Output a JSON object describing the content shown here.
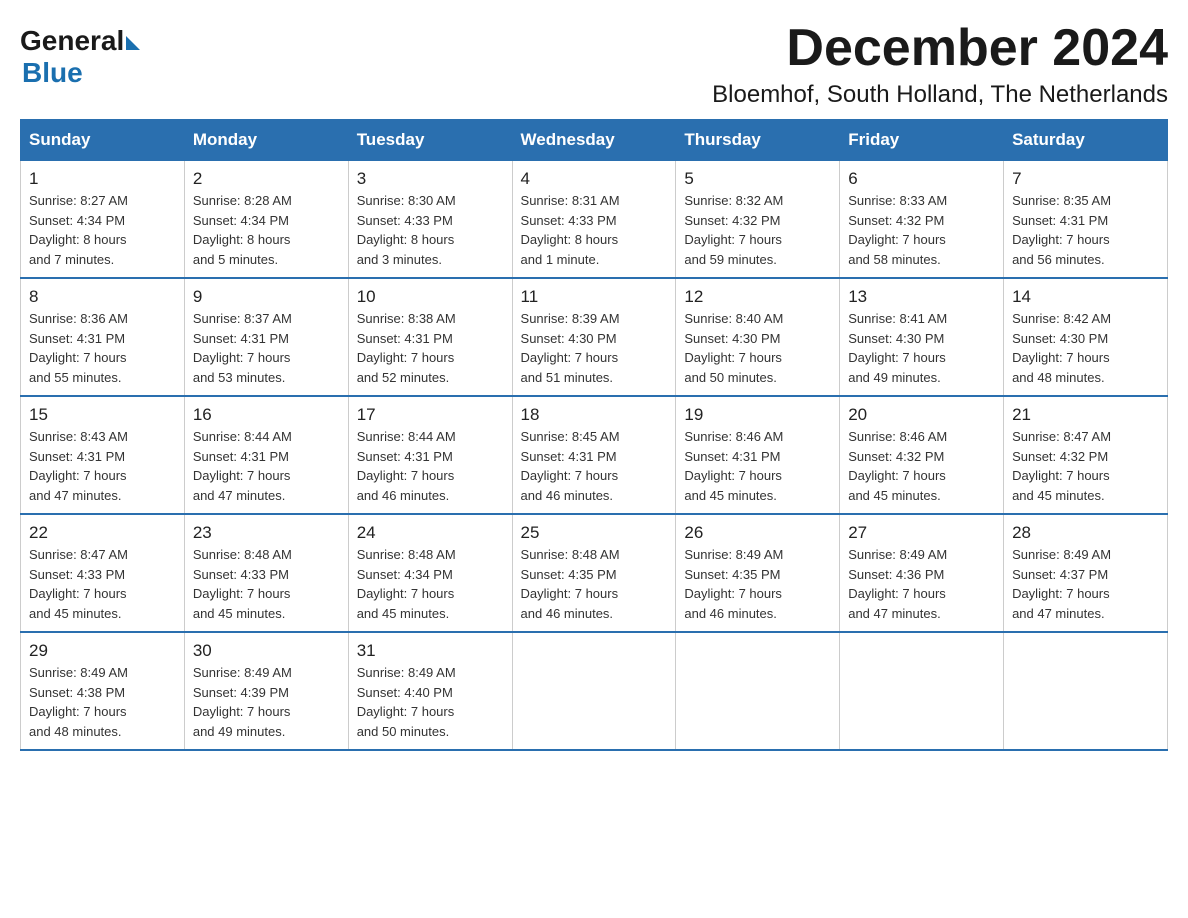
{
  "logo": {
    "general": "General",
    "blue": "Blue"
  },
  "title": {
    "month": "December 2024",
    "location": "Bloemhof, South Holland, The Netherlands"
  },
  "weekdays": [
    "Sunday",
    "Monday",
    "Tuesday",
    "Wednesday",
    "Thursday",
    "Friday",
    "Saturday"
  ],
  "weeks": [
    [
      {
        "day": "1",
        "sunrise": "8:27 AM",
        "sunset": "4:34 PM",
        "daylight": "8 hours and 7 minutes."
      },
      {
        "day": "2",
        "sunrise": "8:28 AM",
        "sunset": "4:34 PM",
        "daylight": "8 hours and 5 minutes."
      },
      {
        "day": "3",
        "sunrise": "8:30 AM",
        "sunset": "4:33 PM",
        "daylight": "8 hours and 3 minutes."
      },
      {
        "day": "4",
        "sunrise": "8:31 AM",
        "sunset": "4:33 PM",
        "daylight": "8 hours and 1 minute."
      },
      {
        "day": "5",
        "sunrise": "8:32 AM",
        "sunset": "4:32 PM",
        "daylight": "7 hours and 59 minutes."
      },
      {
        "day": "6",
        "sunrise": "8:33 AM",
        "sunset": "4:32 PM",
        "daylight": "7 hours and 58 minutes."
      },
      {
        "day": "7",
        "sunrise": "8:35 AM",
        "sunset": "4:31 PM",
        "daylight": "7 hours and 56 minutes."
      }
    ],
    [
      {
        "day": "8",
        "sunrise": "8:36 AM",
        "sunset": "4:31 PM",
        "daylight": "7 hours and 55 minutes."
      },
      {
        "day": "9",
        "sunrise": "8:37 AM",
        "sunset": "4:31 PM",
        "daylight": "7 hours and 53 minutes."
      },
      {
        "day": "10",
        "sunrise": "8:38 AM",
        "sunset": "4:31 PM",
        "daylight": "7 hours and 52 minutes."
      },
      {
        "day": "11",
        "sunrise": "8:39 AM",
        "sunset": "4:30 PM",
        "daylight": "7 hours and 51 minutes."
      },
      {
        "day": "12",
        "sunrise": "8:40 AM",
        "sunset": "4:30 PM",
        "daylight": "7 hours and 50 minutes."
      },
      {
        "day": "13",
        "sunrise": "8:41 AM",
        "sunset": "4:30 PM",
        "daylight": "7 hours and 49 minutes."
      },
      {
        "day": "14",
        "sunrise": "8:42 AM",
        "sunset": "4:30 PM",
        "daylight": "7 hours and 48 minutes."
      }
    ],
    [
      {
        "day": "15",
        "sunrise": "8:43 AM",
        "sunset": "4:31 PM",
        "daylight": "7 hours and 47 minutes."
      },
      {
        "day": "16",
        "sunrise": "8:44 AM",
        "sunset": "4:31 PM",
        "daylight": "7 hours and 47 minutes."
      },
      {
        "day": "17",
        "sunrise": "8:44 AM",
        "sunset": "4:31 PM",
        "daylight": "7 hours and 46 minutes."
      },
      {
        "day": "18",
        "sunrise": "8:45 AM",
        "sunset": "4:31 PM",
        "daylight": "7 hours and 46 minutes."
      },
      {
        "day": "19",
        "sunrise": "8:46 AM",
        "sunset": "4:31 PM",
        "daylight": "7 hours and 45 minutes."
      },
      {
        "day": "20",
        "sunrise": "8:46 AM",
        "sunset": "4:32 PM",
        "daylight": "7 hours and 45 minutes."
      },
      {
        "day": "21",
        "sunrise": "8:47 AM",
        "sunset": "4:32 PM",
        "daylight": "7 hours and 45 minutes."
      }
    ],
    [
      {
        "day": "22",
        "sunrise": "8:47 AM",
        "sunset": "4:33 PM",
        "daylight": "7 hours and 45 minutes."
      },
      {
        "day": "23",
        "sunrise": "8:48 AM",
        "sunset": "4:33 PM",
        "daylight": "7 hours and 45 minutes."
      },
      {
        "day": "24",
        "sunrise": "8:48 AM",
        "sunset": "4:34 PM",
        "daylight": "7 hours and 45 minutes."
      },
      {
        "day": "25",
        "sunrise": "8:48 AM",
        "sunset": "4:35 PM",
        "daylight": "7 hours and 46 minutes."
      },
      {
        "day": "26",
        "sunrise": "8:49 AM",
        "sunset": "4:35 PM",
        "daylight": "7 hours and 46 minutes."
      },
      {
        "day": "27",
        "sunrise": "8:49 AM",
        "sunset": "4:36 PM",
        "daylight": "7 hours and 47 minutes."
      },
      {
        "day": "28",
        "sunrise": "8:49 AM",
        "sunset": "4:37 PM",
        "daylight": "7 hours and 47 minutes."
      }
    ],
    [
      {
        "day": "29",
        "sunrise": "8:49 AM",
        "sunset": "4:38 PM",
        "daylight": "7 hours and 48 minutes."
      },
      {
        "day": "30",
        "sunrise": "8:49 AM",
        "sunset": "4:39 PM",
        "daylight": "7 hours and 49 minutes."
      },
      {
        "day": "31",
        "sunrise": "8:49 AM",
        "sunset": "4:40 PM",
        "daylight": "7 hours and 50 minutes."
      },
      null,
      null,
      null,
      null
    ]
  ]
}
